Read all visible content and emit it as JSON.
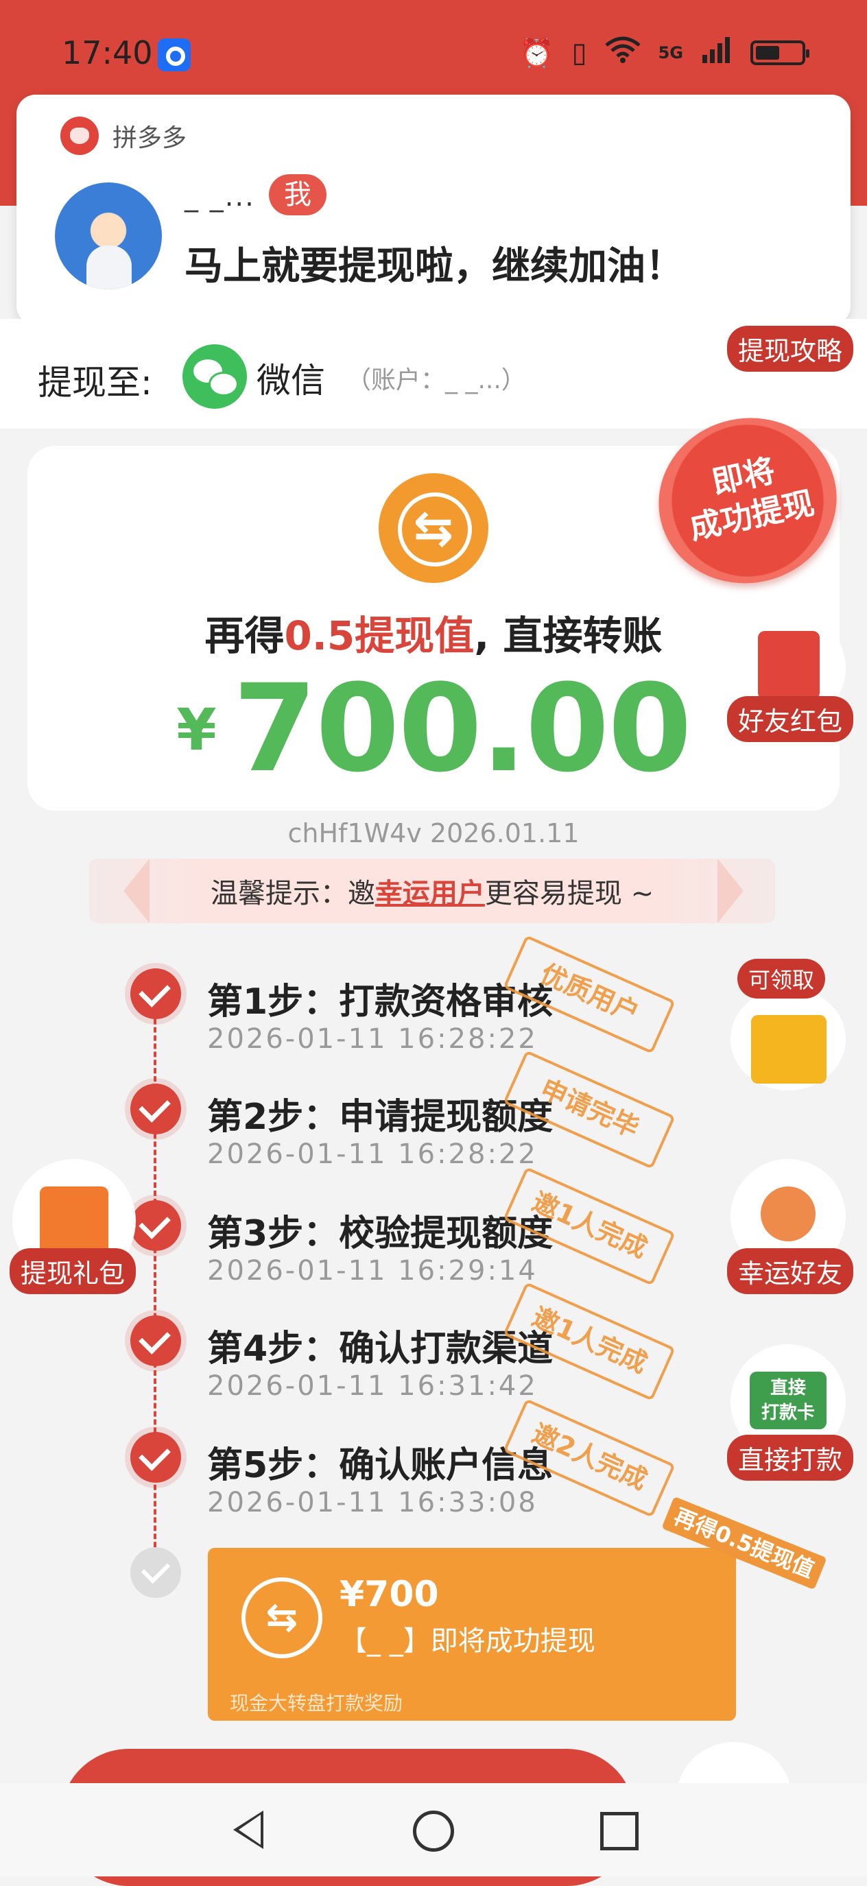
{
  "status_bar": {
    "time": "17:40",
    "network": "5G"
  },
  "notification": {
    "app_name": "拼多多",
    "user_name": "_ _...",
    "badge": "我",
    "message": "马上就要提现啦，继续加油！"
  },
  "withdraw": {
    "label": "提现至:",
    "method": "微信",
    "account": "（账户：_ _...）"
  },
  "side": {
    "strategy": "提现攻略",
    "friend_red_packet": "好友红包",
    "claimable": "可领取",
    "gift_pack": "提现礼包",
    "lucky_friend": "幸运好友",
    "direct_pay": "直接打款",
    "direct_card_line1": "直接",
    "direct_card_line2": "打款卡"
  },
  "seal": {
    "line1": "即将",
    "line2": "成功提现"
  },
  "amount_card": {
    "caption_prefix": "再得",
    "caption_highlight": "0.5提现值",
    "caption_suffix": ", 直接转账",
    "currency": "¥",
    "amount": "700.00"
  },
  "meta_id": "chHf1W4v 2026.01.11",
  "tip": {
    "prefix": "温馨提示：邀",
    "highlight": "幸运用户",
    "suffix": "更容易提现 ~"
  },
  "steps": [
    {
      "title": "第1步：打款资格审核",
      "time": "2026-01-11 16:28:22",
      "stamp": "优质用户"
    },
    {
      "title": "第2步：申请提现额度",
      "time": "2026-01-11 16:28:22",
      "stamp": "申请完毕"
    },
    {
      "title": "第3步：校验提现额度",
      "time": "2026-01-11 16:29:14",
      "stamp": "邀1人完成"
    },
    {
      "title": "第4步：确认打款渠道",
      "time": "2026-01-11 16:31:42",
      "stamp": "邀1人完成"
    },
    {
      "title": "第5步：确认账户信息",
      "time": "2026-01-11 16:33:08",
      "stamp": "邀2人完成"
    }
  ],
  "final_card": {
    "amount": "¥700",
    "text": "【_ _】即将成功提现",
    "footer": "现金大转盘打款奖励",
    "ribbon": "再得0.5提现值"
  },
  "colors": {
    "brand_red": "#d9453a",
    "amount_green": "#53b959",
    "orange": "#f39a34"
  }
}
